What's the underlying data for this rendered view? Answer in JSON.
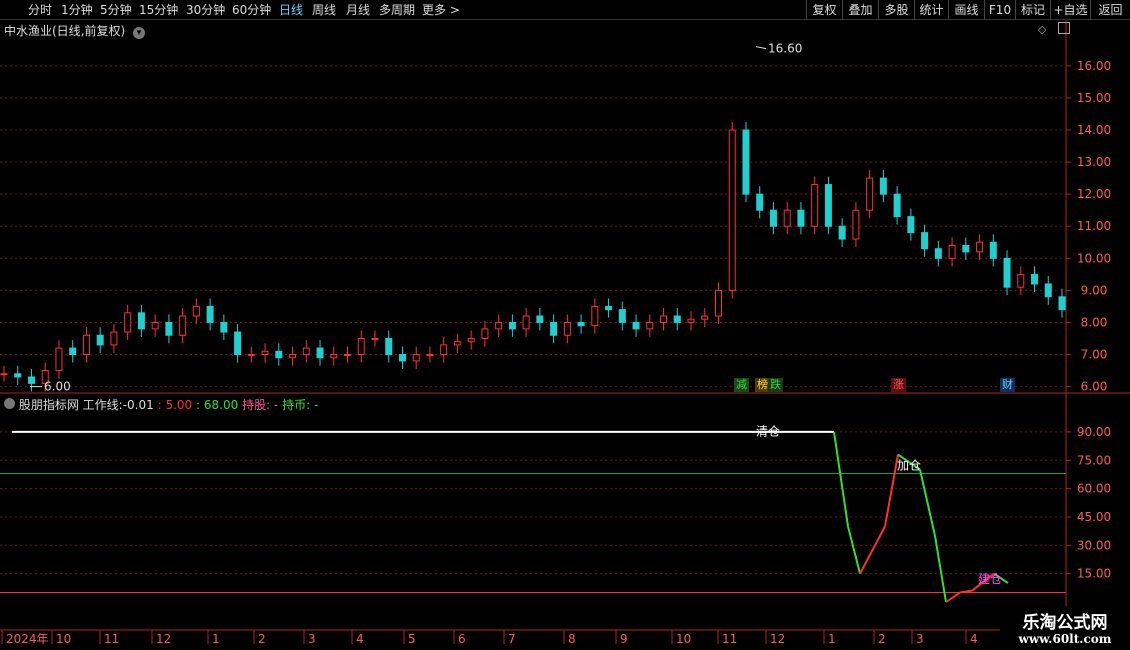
{
  "toolbar": {
    "periods": [
      "分时",
      "1分钟",
      "5分钟",
      "15分钟",
      "30分钟",
      "60分钟",
      "日线",
      "周线",
      "月线",
      "多周期",
      "更多 >"
    ],
    "active_period": "日线",
    "right_buttons": [
      "复权",
      "叠加",
      "多股",
      "统计",
      "画线",
      "F10",
      "标记",
      "+自选",
      "返回"
    ]
  },
  "main_panel": {
    "title": "中水渔业(日线,前复权)",
    "price_labels": [
      "16.00",
      "15.00",
      "14.00",
      "13.00",
      "12.00",
      "11.00",
      "10.00",
      "9.00",
      "8.00",
      "7.00",
      "6.00"
    ],
    "high_marker": "16.60",
    "low_marker": "6.00",
    "badges": [
      {
        "text": "减",
        "color": "#3cd23c",
        "bg": "#1a4a1a"
      },
      {
        "text": "榜",
        "color": "#ffd23c",
        "bg": "#4a3a10"
      },
      {
        "text": "跌",
        "color": "#3cd23c",
        "bg": "#1a3a1a"
      },
      {
        "text": "涨",
        "color": "#ff5a5a",
        "bg": "#5a1010"
      },
      {
        "text": "财",
        "color": "#6ecbff",
        "bg": "#10305a"
      }
    ]
  },
  "indicator_panel": {
    "name": "股朋指标网",
    "worker_label": "工作线:",
    "worker_value": "-0.01",
    "v1": ": 5.00",
    "v2": ": 68.00",
    "hold_label": "持股: -",
    "coin_label": "持币: -",
    "levels": [
      "90.00",
      "75.00",
      "60.00",
      "45.00",
      "30.00",
      "15.00"
    ],
    "annotations": [
      "清仓",
      "加仓",
      "建仓"
    ],
    "colors": {
      "up": "#ff3030",
      "down": "#30e030",
      "flat": "#ffffff",
      "guide": "#1fa51f",
      "base": "#ff3030"
    }
  },
  "time_axis": {
    "labels": [
      "2024年",
      "10",
      "11",
      "12",
      "1",
      "2",
      "3",
      "4",
      "5",
      "6",
      "7",
      "8",
      "9",
      "10",
      "11",
      "12",
      "1",
      "2",
      "3",
      "4"
    ]
  },
  "watermark": {
    "title": "乐淘公式网",
    "url": "www.60lt.com"
  },
  "chart_data": {
    "type": "candlestick",
    "y_range": [
      5.8,
      16.9
    ],
    "annotated_high": 16.6,
    "annotated_low": 6.0,
    "closes": [
      6.4,
      6.3,
      6.1,
      6.5,
      7.2,
      7.0,
      7.6,
      7.3,
      7.7,
      8.3,
      7.8,
      8.0,
      7.6,
      8.2,
      8.5,
      8.0,
      7.7,
      7.0,
      7.0,
      7.1,
      6.9,
      7.0,
      7.2,
      6.9,
      7.0,
      7.0,
      7.5,
      7.5,
      7.0,
      6.8,
      7.0,
      7.0,
      7.3,
      7.4,
      7.5,
      7.8,
      8.0,
      7.8,
      8.2,
      8.0,
      7.6,
      8.0,
      7.9,
      8.5,
      8.4,
      8.0,
      7.8,
      8.0,
      8.2,
      8.0,
      8.1,
      8.2,
      9.0,
      14.0,
      12.0,
      11.5,
      11.0,
      11.5,
      11.0,
      12.3,
      11.0,
      10.6,
      11.5,
      12.5,
      12.0,
      11.3,
      10.8,
      10.3,
      10.0,
      10.4,
      10.2,
      10.5,
      10.0,
      9.1,
      9.5,
      9.2,
      8.8,
      8.4
    ],
    "indicator": {
      "type": "line",
      "y_range": [
        0,
        100
      ],
      "flat_level": 90,
      "guide_level": 68,
      "base_level": 5,
      "path_values": [
        90,
        90,
        90,
        40,
        15,
        30,
        40,
        78,
        70,
        35,
        -0.01,
        5,
        6,
        15,
        10
      ]
    }
  }
}
